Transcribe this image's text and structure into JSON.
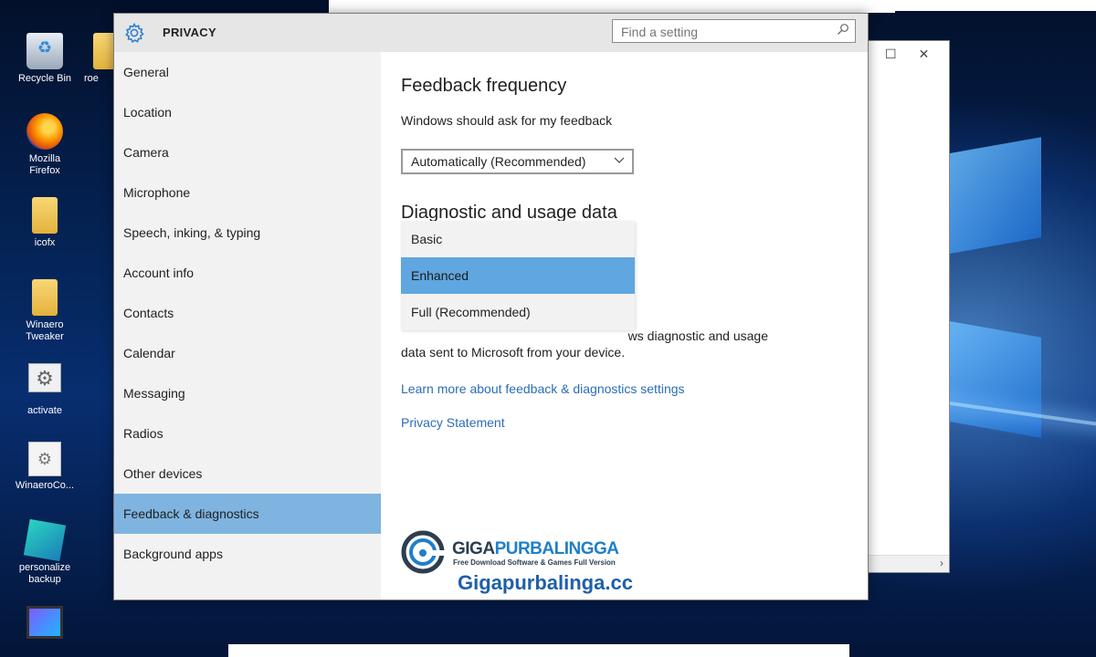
{
  "desktop": {
    "icons": [
      {
        "label": "Recycle Bin",
        "icon": "recycle-bin-icon"
      },
      {
        "label": "roe",
        "icon": "folder-icon"
      },
      {
        "label": "Mozilla Firefox",
        "icon": "firefox-icon"
      },
      {
        "label": "icofx",
        "icon": "file-icon"
      },
      {
        "label": "Winaero Tweaker",
        "icon": "file-icon"
      },
      {
        "label": "activate",
        "icon": "gear-file-icon"
      },
      {
        "label": "WinaeroCo...",
        "icon": "gear-file-icon"
      },
      {
        "label": "personalize backup",
        "icon": "app-icon"
      },
      {
        "label": "",
        "icon": "monitor-icon"
      }
    ]
  },
  "settings": {
    "title": "PRIVACY",
    "search_placeholder": "Find a setting",
    "sidebar": [
      {
        "label": "General"
      },
      {
        "label": "Location"
      },
      {
        "label": "Camera"
      },
      {
        "label": "Microphone"
      },
      {
        "label": "Speech, inking, & typing"
      },
      {
        "label": "Account info"
      },
      {
        "label": "Contacts"
      },
      {
        "label": "Calendar"
      },
      {
        "label": "Messaging"
      },
      {
        "label": "Radios"
      },
      {
        "label": "Other devices"
      },
      {
        "label": "Feedback & diagnostics",
        "selected": true
      },
      {
        "label": "Background apps"
      }
    ],
    "feedback_heading": "Feedback frequency",
    "feedback_label": "Windows should ask for my feedback",
    "feedback_value": "Automatically (Recommended)",
    "diag_heading": "Diagnostic and usage data",
    "dropdown_options": [
      {
        "label": "Basic"
      },
      {
        "label": "Enhanced",
        "selected": true
      },
      {
        "label": "Full (Recommended)"
      }
    ],
    "diag_text_line1_visible": "ws diagnostic and usage",
    "diag_text_line2": "data sent to Microsoft from your device.",
    "link_learn_more": "Learn more about feedback & diagnostics settings",
    "link_privacy": "Privacy Statement"
  },
  "watermark": {
    "brand_a": "GIGA",
    "brand_b": "PURBALINGGA",
    "tagline": "Free Download Software & Games Full Version",
    "site": "Gigapurbalinga.cc"
  },
  "colors": {
    "selected_nav": "#7fb4e0",
    "selected_option": "#60a6e0",
    "link": "#2a6db8",
    "sidebar_bg": "#f2f2f2"
  }
}
